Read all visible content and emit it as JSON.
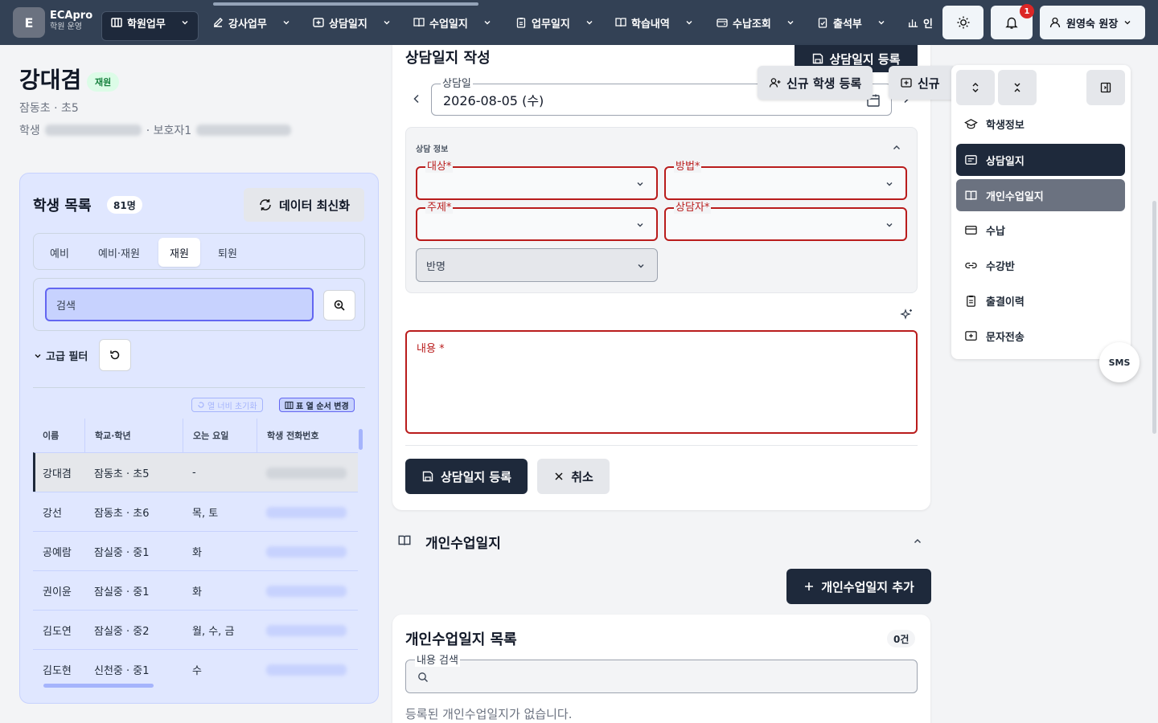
{
  "app": {
    "logo_letter": "E",
    "name": "ECApro",
    "sub": "학원 운영"
  },
  "nav": [
    {
      "label": "학원업무",
      "icon": "building-icon"
    },
    {
      "label": "강사업무",
      "icon": "edit-icon"
    },
    {
      "label": "상담일지",
      "icon": "chat-plus-icon"
    },
    {
      "label": "수업일지",
      "icon": "book-icon"
    },
    {
      "label": "업무일지",
      "icon": "clipboard-icon"
    },
    {
      "label": "학습내역",
      "icon": "book-open-icon"
    },
    {
      "label": "수납조회",
      "icon": "wallet-icon"
    },
    {
      "label": "출석부",
      "icon": "check-clipboard-icon"
    },
    {
      "label": "인",
      "icon": "chart-icon"
    }
  ],
  "topbar": {
    "notif_count": "1",
    "user": "원영숙 원장"
  },
  "student": {
    "name": "강대겸",
    "status": "재원",
    "school": "잠동초 · 초5",
    "phone_label": "학생",
    "guardian_label": "· 보호자1"
  },
  "list": {
    "title": "학생 목록",
    "count": "81명",
    "refresh": "데이터 최신화",
    "tabs": [
      "예비",
      "예비·재원",
      "재원",
      "퇴원"
    ],
    "search_placeholder": "검색",
    "adv_filter": "고급 필터",
    "col_reset": "열 너비 초기화",
    "col_order": "표 열 순서 변경",
    "columns": [
      "이름",
      "학교·학년",
      "오는 요일",
      "학생 전화번호"
    ],
    "rows": [
      {
        "name": "강대겸",
        "school": "잠동초 · 초5",
        "days": "-"
      },
      {
        "name": "강선",
        "school": "잠동초 · 초6",
        "days": "목, 토"
      },
      {
        "name": "공예람",
        "school": "잠실중 · 중1",
        "days": "화"
      },
      {
        "name": "권이윤",
        "school": "잠실중 · 중1",
        "days": "화"
      },
      {
        "name": "김도연",
        "school": "잠실중 · 중2",
        "days": "월, 수, 금"
      },
      {
        "name": "김도현",
        "school": "신천중 · 중1",
        "days": "수"
      }
    ]
  },
  "form": {
    "title": "상담일지 작성",
    "register_top": "상담일지 등록",
    "new_student": "신규 학생 등록",
    "new_short": "신규",
    "date_label": "상담일",
    "date_value": "2026-08-05 (수)",
    "section": "상담 정보",
    "target": "대상",
    "method": "방법",
    "topic": "주제",
    "counselor": "상담자",
    "class_name": "반명",
    "content": "내용",
    "required_mark": "*",
    "submit": "상담일지 등록",
    "cancel": "취소"
  },
  "private_log": {
    "title": "개인수업일지",
    "add": "개인수업일지 추가",
    "list_title": "개인수업일지 목록",
    "count": "0건",
    "search_label": "내용 검색",
    "empty": "등록된 개인수업일지가 없습니다."
  },
  "side": {
    "items": [
      {
        "label": "학생정보",
        "icon": "graduation-cap-icon"
      },
      {
        "label": "상담일지",
        "icon": "message-square-icon"
      },
      {
        "label": "개인수업일지",
        "icon": "book-open-icon"
      },
      {
        "label": "수납",
        "icon": "credit-card-icon"
      },
      {
        "label": "수강반",
        "icon": "link-icon"
      },
      {
        "label": "출결이력",
        "icon": "clipboard-list-icon"
      },
      {
        "label": "문자전송",
        "icon": "message-plus-icon"
      }
    ],
    "sms": "SMS"
  }
}
